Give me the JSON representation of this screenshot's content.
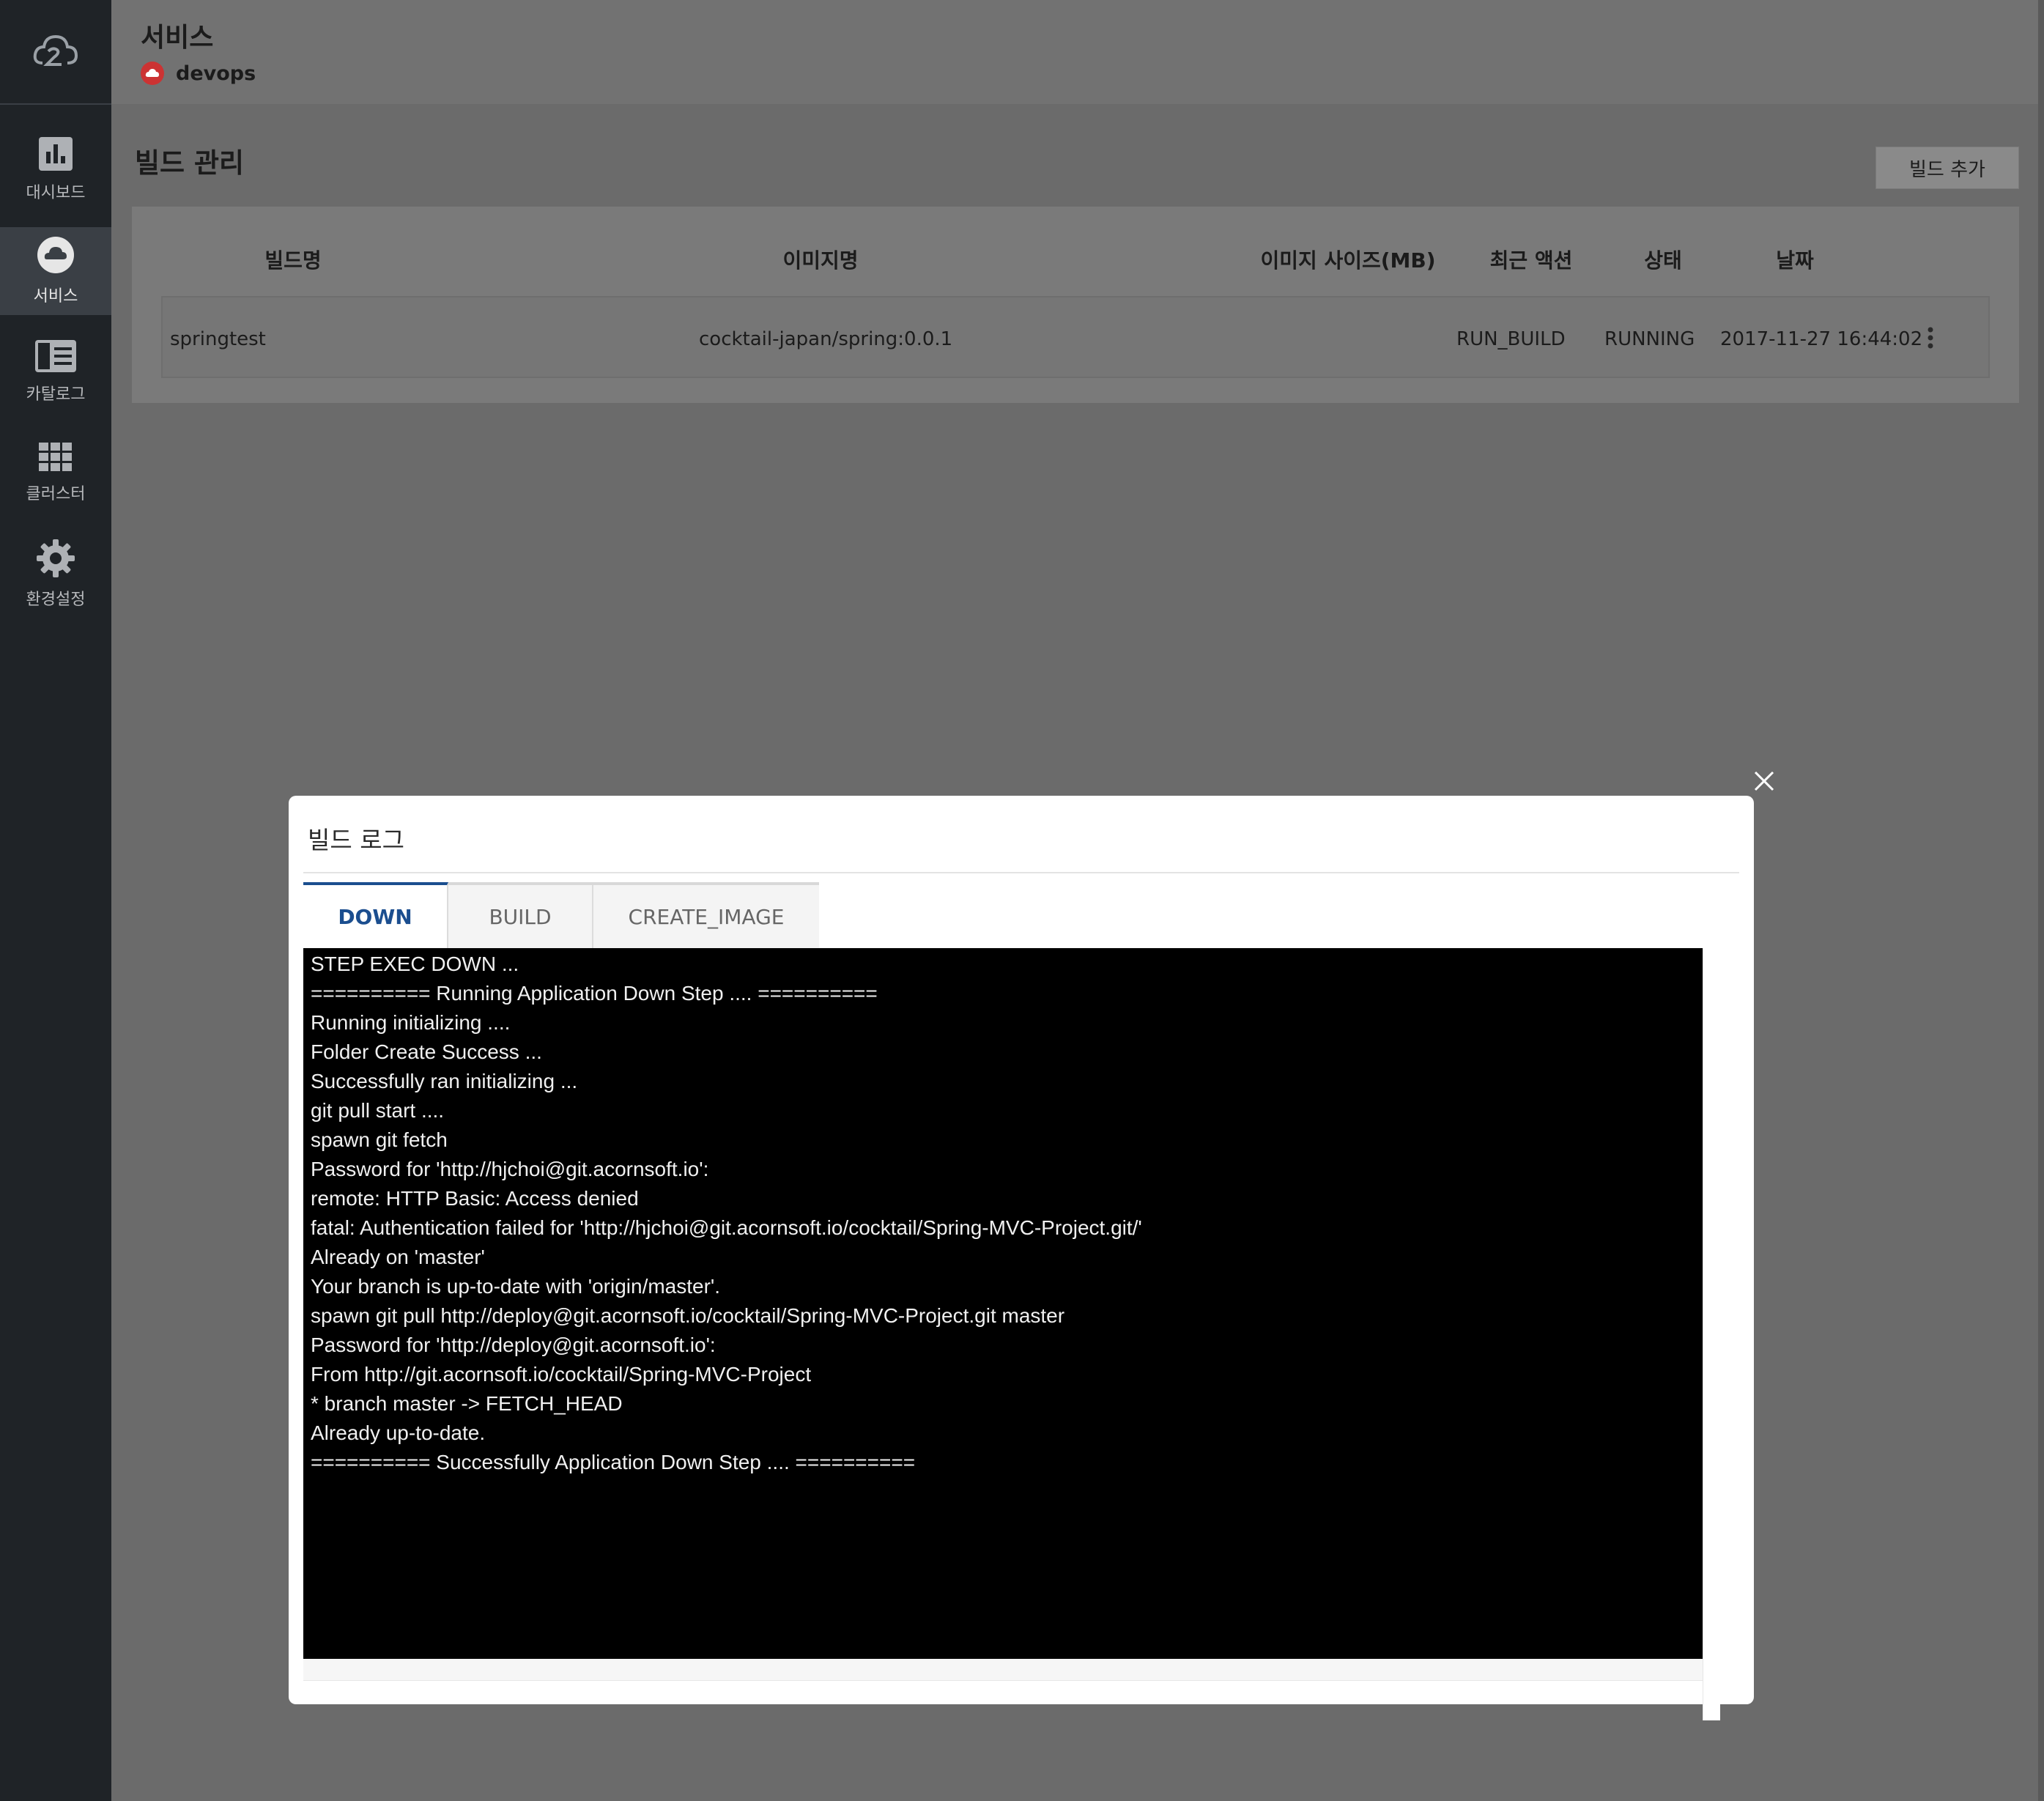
{
  "sidebar": {
    "items": [
      {
        "label": "대시보드",
        "icon": "bar-chart-icon"
      },
      {
        "label": "서비스",
        "icon": "cloud-icon"
      },
      {
        "label": "카탈로그",
        "icon": "catalog-icon"
      },
      {
        "label": "클러스터",
        "icon": "grid-icon"
      },
      {
        "label": "환경설정",
        "icon": "gear-icon"
      }
    ],
    "active_index": 1
  },
  "header": {
    "title": "서비스",
    "subtitle": "devops"
  },
  "page": {
    "title": "빌드 관리",
    "add_button": "빌드 추가"
  },
  "table": {
    "columns": [
      "빌드명",
      "이미지명",
      "이미지 사이즈(MB)",
      "최근 액션",
      "상태",
      "날짜"
    ],
    "rows": [
      {
        "name": "springtest",
        "image": "cocktail-japan/spring:0.0.1",
        "size": "",
        "action": "RUN_BUILD",
        "status": "RUNNING",
        "date": "2017-11-27 16:44:02"
      }
    ]
  },
  "modal": {
    "title": "빌드 로그",
    "tabs": [
      "DOWN",
      "BUILD",
      "CREATE_IMAGE"
    ],
    "active_tab": 0,
    "log_lines": [
      "STEP EXEC DOWN ...",
      "========== Running Application Down Step .... ==========",
      "Running initializing ....",
      "Folder Create Success ...",
      "Successfully ran initializing ...",
      "git pull start ....",
      "spawn git fetch",
      "Password for 'http://hjchoi@git.acornsoft.io':",
      "remote: HTTP Basic: Access denied",
      "fatal: Authentication failed for 'http://hjchoi@git.acornsoft.io/cocktail/Spring-MVC-Project.git/'",
      "Already on 'master'",
      "Your branch is up-to-date with 'origin/master'.",
      "spawn git pull http://deploy@git.acornsoft.io/cocktail/Spring-MVC-Project.git master",
      "Password for 'http://deploy@git.acornsoft.io':",
      "From http://git.acornsoft.io/cocktail/Spring-MVC-Project",
      "* branch master -> FETCH_HEAD",
      "Already up-to-date.",
      "========== Successfully Application Down Step .... =========="
    ]
  },
  "colors": {
    "accent": "#1b4e8f",
    "sidebar_bg": "#1f2327",
    "service_badge": "#cc3333"
  }
}
